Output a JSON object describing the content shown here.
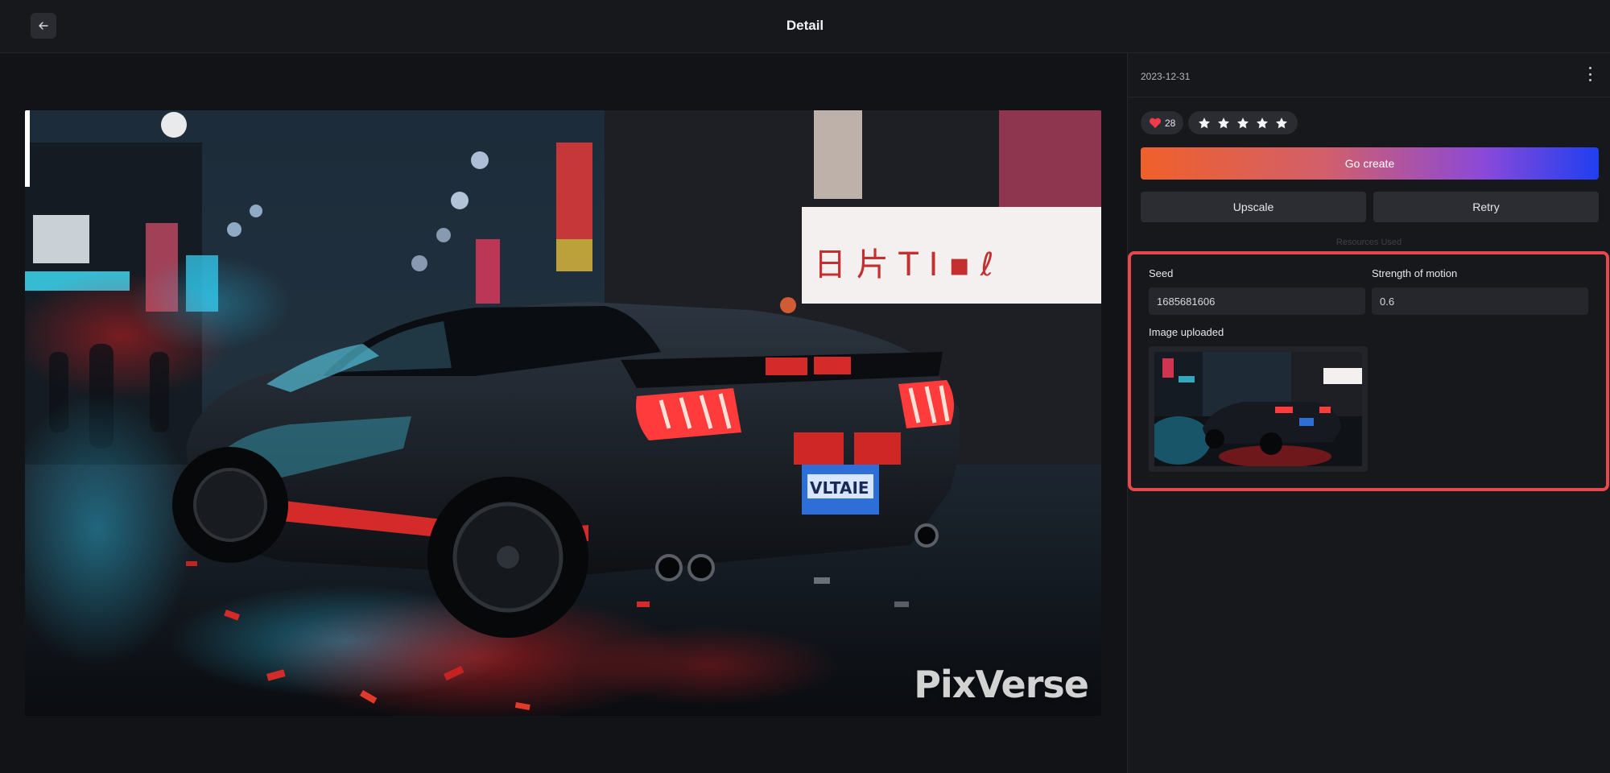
{
  "header": {
    "title": "Detail",
    "back_icon": "arrow-left-icon"
  },
  "main_image": {
    "description_icon": "generated-image",
    "watermark": "PixVerse"
  },
  "panel": {
    "date": "2023-12-31",
    "more_icon": "more-vertical-icon",
    "likes": "28",
    "like_icon": "heart-icon",
    "rating": 5,
    "go_create_label": "Go create",
    "upscale_label": "Upscale",
    "retry_label": "Retry",
    "resources_label": "Resources Used",
    "seed_label": "Seed",
    "seed_value": "1685681606",
    "motion_label": "Strength of motion",
    "motion_value": "0.6",
    "upload_label": "Image uploaded"
  },
  "colors": {
    "background": "#121316",
    "panel": "#17181b",
    "highlight_border": "#e5484d",
    "gradient_start": "#f0602a",
    "gradient_end": "#1f3ff0"
  }
}
